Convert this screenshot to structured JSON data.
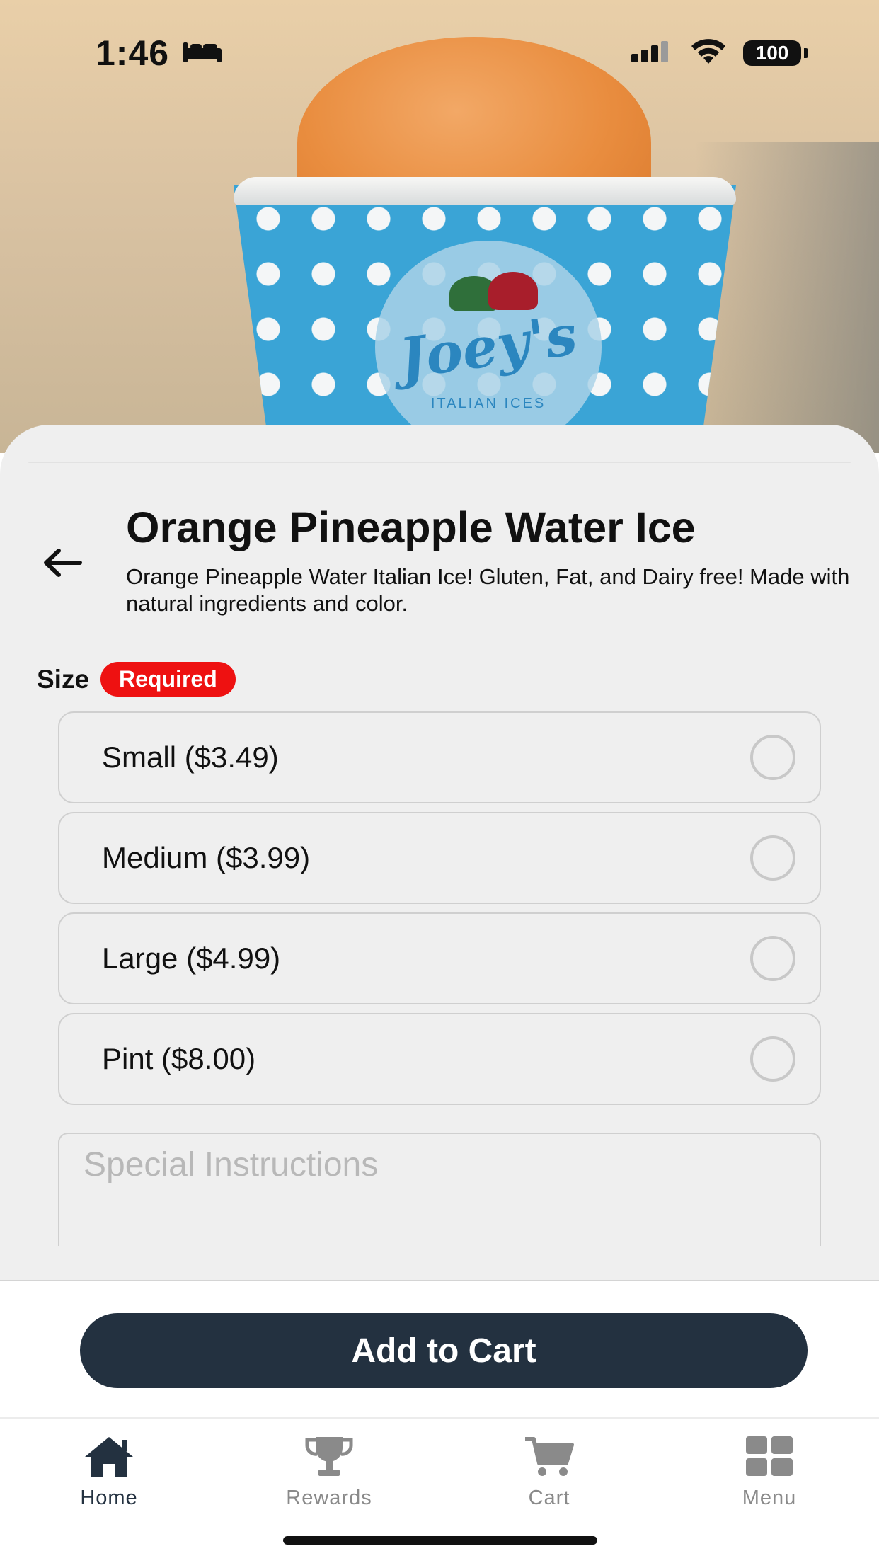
{
  "status_bar": {
    "time": "1:46",
    "battery": "100"
  },
  "hero": {
    "logo_text": "Joey's",
    "logo_subtext": "ITALIAN ICES"
  },
  "product": {
    "title": "Orange Pineapple Water Ice",
    "description": "Orange Pineapple Water Italian Ice! Gluten, Fat, and Dairy free! Made with natural ingredients and color."
  },
  "size": {
    "label": "Size",
    "badge": "Required",
    "badge_color": "#ee1111",
    "options": [
      {
        "label": "Small ($3.49)",
        "selected": false
      },
      {
        "label": "Medium ($3.99)",
        "selected": false
      },
      {
        "label": "Large ($4.99)",
        "selected": false
      },
      {
        "label": "Pint ($8.00)",
        "selected": false
      }
    ]
  },
  "special_instructions": {
    "placeholder": "Special Instructions",
    "value": ""
  },
  "cart": {
    "button_label": "Add to Cart",
    "button_color": "#233140"
  },
  "tab_bar": {
    "active": "Home",
    "tabs": [
      {
        "label": "Home",
        "icon": "home-icon"
      },
      {
        "label": "Rewards",
        "icon": "trophy-icon"
      },
      {
        "label": "Cart",
        "icon": "cart-icon"
      },
      {
        "label": "Menu",
        "icon": "grid-icon"
      }
    ]
  }
}
